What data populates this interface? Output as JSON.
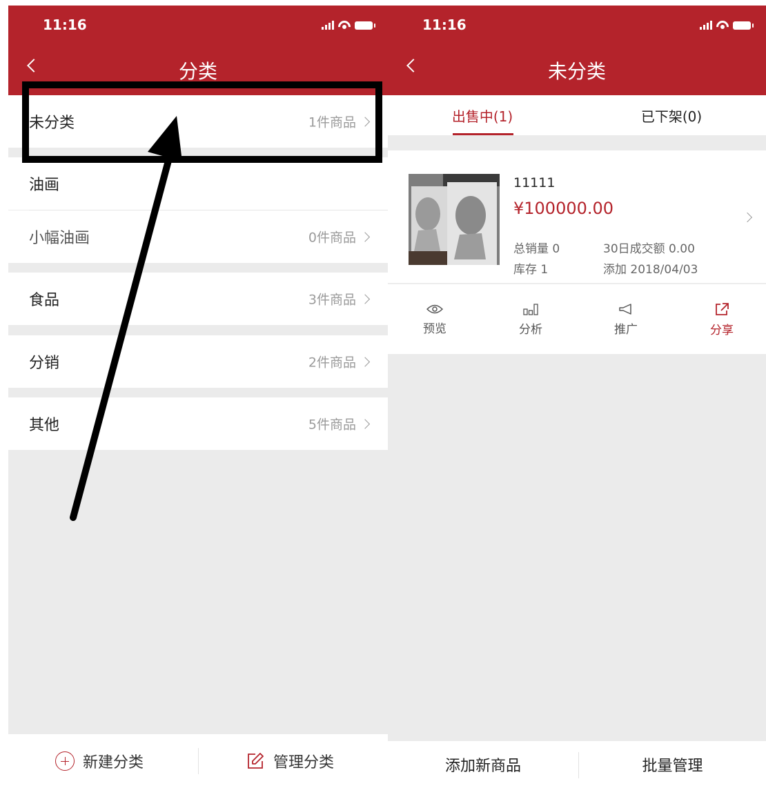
{
  "left": {
    "status": {
      "time": "11:16"
    },
    "nav": {
      "title": "分类"
    },
    "categories": [
      {
        "name": "未分类",
        "count": "1件商品"
      },
      {
        "name": "油画",
        "count": ""
      },
      {
        "name": "小幅油画",
        "count": "0件商品"
      },
      {
        "name": "食品",
        "count": "3件商品"
      },
      {
        "name": "分销",
        "count": "2件商品"
      },
      {
        "name": "其他",
        "count": "5件商品"
      }
    ],
    "bottom": {
      "new_label": "新建分类",
      "manage_label": "管理分类"
    }
  },
  "right": {
    "status": {
      "time": "11:16"
    },
    "nav": {
      "title": "未分类"
    },
    "tabs": [
      {
        "label": "出售中(1)",
        "active": true
      },
      {
        "label": "已下架(0)",
        "active": false
      }
    ],
    "product": {
      "name": "11111",
      "price": "¥100000.00",
      "total_sales": "总销量 0",
      "stock": "库存 1",
      "turnover_30d": "30日成交额 0.00",
      "added": "添加 2018/04/03"
    },
    "actions": [
      {
        "label": "预览",
        "icon": "eye-icon"
      },
      {
        "label": "分析",
        "icon": "bar-chart-icon"
      },
      {
        "label": "推广",
        "icon": "megaphone-icon"
      },
      {
        "label": "分享",
        "icon": "share-icon"
      }
    ],
    "bottom": {
      "add_label": "添加新商品",
      "batch_label": "批量管理"
    }
  },
  "colors": {
    "brand_red": "#b4232b",
    "background": "#ebebeb"
  }
}
